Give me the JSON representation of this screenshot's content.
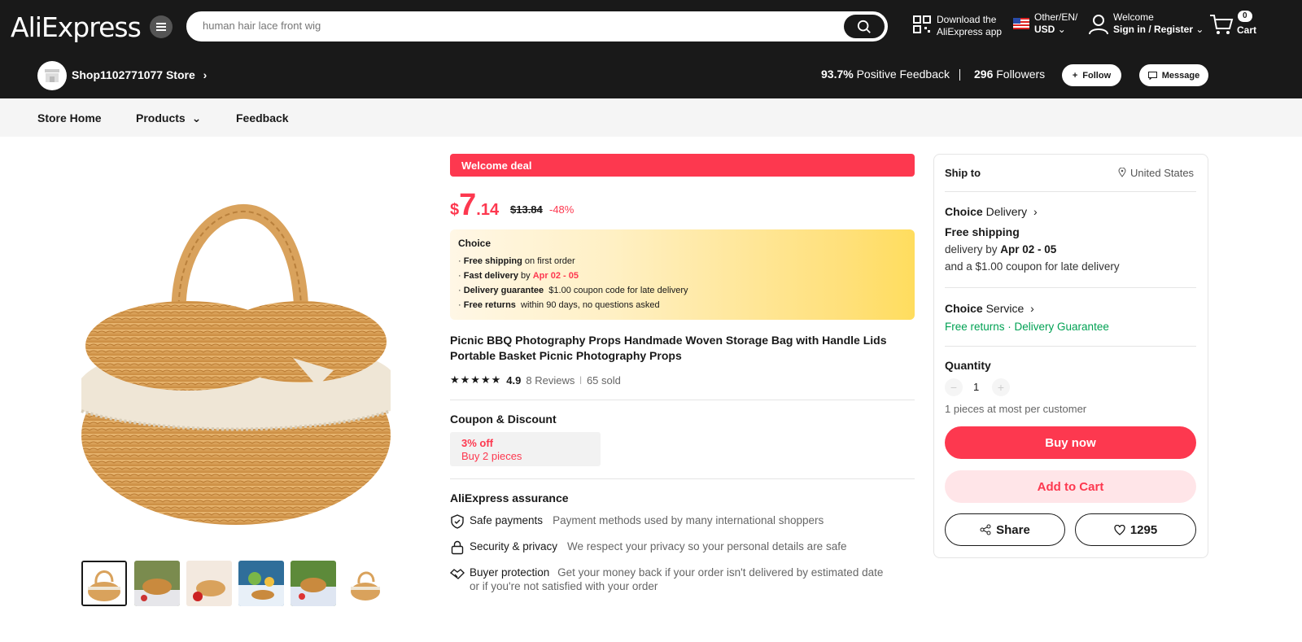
{
  "header": {
    "logo": "AliExpress",
    "search_placeholder": "human hair lace front wig",
    "download_line1": "Download the",
    "download_line2": "AliExpress app",
    "locale_line1": "Other/EN/",
    "locale_line2": "USD",
    "welcome_line1": "Welcome",
    "welcome_line2": "Sign in / Register",
    "cart_count": "0",
    "cart_label": "Cart"
  },
  "store": {
    "name": "Shop1102771077 Store",
    "feedback_pct": "93.7%",
    "feedback_label": "Positive Feedback",
    "followers_count": "296",
    "followers_label": "Followers",
    "follow_label": "Follow",
    "message_label": "Message"
  },
  "nav": {
    "home": "Store Home",
    "products": "Products",
    "feedback": "Feedback"
  },
  "product": {
    "welcome_deal": "Welcome deal",
    "price_currency": "$",
    "price_whole": "7",
    "price_decimal": ".14",
    "old_price": "$13.84",
    "discount": "-48%",
    "choice": {
      "title": "Choice",
      "lines": [
        {
          "bold": "Free shipping",
          "rest": " on first order"
        },
        {
          "bold": "Fast delivery",
          "mid": " by ",
          "red": "Apr 02 - 05"
        },
        {
          "bold": "Delivery guarantee",
          "rest": "  $1.00 coupon code for late delivery"
        },
        {
          "bold": "Free returns",
          "rest": "  within 90 days, no questions asked"
        }
      ]
    },
    "title": "Picnic BBQ Photography Props Handmade Woven Storage Bag with Handle Lids Portable Basket Picnic Photography Props",
    "rating": "4.9",
    "reviews": "8 Reviews",
    "sold": "65 sold",
    "coupon_title": "Coupon & Discount",
    "coupon_off": "3% off",
    "coupon_cond": "Buy 2 pieces",
    "assurance_title": "AliExpress assurance",
    "assurance": [
      {
        "label": "Safe payments",
        "desc": "Payment methods used by many international shoppers"
      },
      {
        "label": "Security & privacy",
        "desc": "We respect your privacy so your personal details are safe"
      },
      {
        "label": "Buyer protection",
        "desc": "Get your money back if your order isn't delivered by estimated date",
        "desc2": "or if you're not satisfied with your order"
      }
    ]
  },
  "panel": {
    "ship_to_label": "Ship to",
    "ship_to_value": "United States",
    "choice_delivery_brand": "Choice",
    "choice_delivery_label": "Delivery",
    "free_shipping": "Free shipping",
    "delivery_by": "delivery by ",
    "delivery_date": "Apr 02 - 05",
    "late_coupon": "and a $1.00 coupon for late delivery",
    "choice_service_brand": "Choice",
    "choice_service_label": "Service",
    "free_returns": "Free returns",
    "delivery_guarantee": "Delivery Guarantee",
    "quantity_label": "Quantity",
    "quantity_value": "1",
    "quantity_limit": "1 pieces at most per customer",
    "buy_now": "Buy now",
    "add_to_cart": "Add to Cart",
    "share": "Share",
    "wishlist_count": "1295"
  },
  "colors": {
    "accent_red": "#fd384f",
    "header_bg": "#191919",
    "green": "#00a153"
  }
}
